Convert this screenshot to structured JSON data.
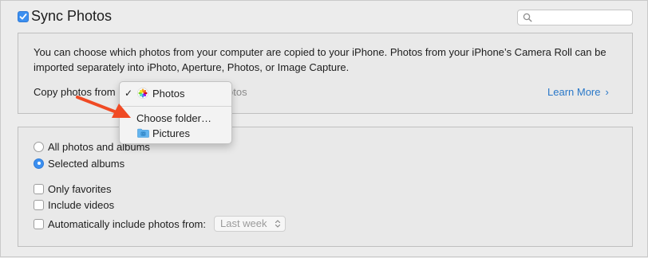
{
  "header": {
    "title": "Sync Photos",
    "sync_checked": true,
    "search": {
      "placeholder": "",
      "value": ""
    }
  },
  "copy_section": {
    "description": "You can choose which photos from your computer are copied to your iPhone. Photos from your iPhone’s Camera Roll can be imported separately into iPhoto, Aperture, Photos, or Image Capture.",
    "copy_from_label": "Copy photos from",
    "selected_source_partial": "otos",
    "learn_more": "Learn More"
  },
  "source_menu": {
    "items": [
      {
        "label": "Photos",
        "checked": true,
        "icon": "photos-app-icon"
      },
      {
        "label": "Choose folder…",
        "checked": false,
        "icon": ""
      },
      {
        "label": "Pictures",
        "checked": false,
        "icon": "folder-icon"
      }
    ]
  },
  "options": {
    "all_photos": {
      "label": "All photos and albums",
      "selected": false
    },
    "selected_albums": {
      "label": "Selected albums",
      "selected": true
    },
    "only_favorites": {
      "label": "Only favorites",
      "checked": false
    },
    "include_videos": {
      "label": "Include videos",
      "checked": false
    },
    "auto_include": {
      "label": "Automatically include photos from:",
      "checked": false,
      "period": "Last week"
    }
  },
  "colors": {
    "accent": "#3b8ff0",
    "link": "#2a78c8",
    "annotation_arrow": "#f04a24"
  }
}
